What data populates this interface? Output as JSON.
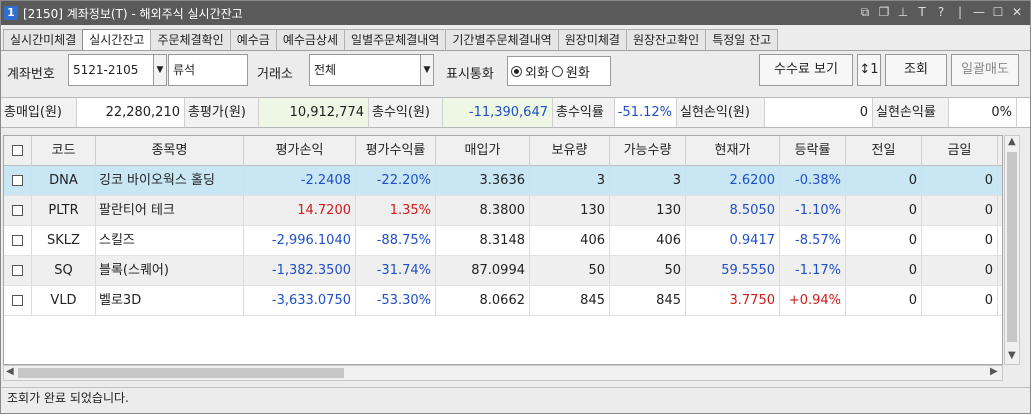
{
  "window": {
    "number": "1",
    "title": "[2150] 계좌정보(T) - 해외주식 실시간잔고",
    "icons": [
      "restore-icon",
      "copy-icon",
      "pin-icon",
      "font-icon",
      "help-icon",
      "minimize-icon",
      "maximize-icon",
      "close-icon"
    ]
  },
  "tabs": [
    {
      "label": "실시간미체결"
    },
    {
      "label": "실시간잔고",
      "active": true
    },
    {
      "label": "주문체결확인"
    },
    {
      "label": "예수금"
    },
    {
      "label": "예수금상세"
    },
    {
      "label": "일별주문체결내역"
    },
    {
      "label": "기간별주문체결내역"
    },
    {
      "label": "원장미체결"
    },
    {
      "label": "원장잔고확인"
    },
    {
      "label": "특정일 잔고"
    }
  ],
  "filter": {
    "account_label": "계좌번호",
    "account_value": "5121-2105",
    "account_name": "류석",
    "exchange_label": "거래소",
    "exchange_value": "전체",
    "currency_label": "표시통화",
    "radio_foreign": "외화",
    "radio_won": "원화",
    "fee_button": "수수료 보기",
    "query_button": "조회",
    "sell_all_button": "일괄매도"
  },
  "summary": {
    "total_buy_label": "총매입(원)",
    "total_buy_value": "22,280,210",
    "total_eval_label": "총평가(원)",
    "total_eval_value": "10,912,774",
    "total_profit_label": "총수익(원)",
    "total_profit_value": "-11,390,647",
    "total_rate_label": "총수익률",
    "total_rate_value": "-51.12%",
    "realized_label": "실현손익(원)",
    "realized_value": "0",
    "realized_rate_label": "실현손익률",
    "realized_rate_value": "0%"
  },
  "table": {
    "headers": [
      "코드",
      "종목명",
      "평가손익",
      "평가수익률",
      "매입가",
      "보유량",
      "가능수량",
      "현재가",
      "등락률",
      "전일",
      "금일"
    ],
    "rows": [
      {
        "code": "DNA",
        "name": "깅코 바이오웍스 홀딩",
        "pnl": "-2.2408",
        "rate": "-22.20%",
        "buy": "3.3636",
        "qty": "3",
        "avail": "3",
        "price": "2.6200",
        "chg": "-0.38%",
        "prev": "0",
        "today": "0"
      },
      {
        "code": "PLTR",
        "name": "팔란티어 테크",
        "pnl": "14.7200",
        "rate": "1.35%",
        "buy": "8.3800",
        "qty": "130",
        "avail": "130",
        "price": "8.5050",
        "chg": "-1.10%",
        "prev": "0",
        "today": "0"
      },
      {
        "code": "SKLZ",
        "name": "스킬즈",
        "pnl": "-2,996.1040",
        "rate": "-88.75%",
        "buy": "8.3148",
        "qty": "406",
        "avail": "406",
        "price": "0.9417",
        "chg": "-8.57%",
        "prev": "0",
        "today": "0"
      },
      {
        "code": "SQ",
        "name": "블록(스퀘어)",
        "pnl": "-1,382.3500",
        "rate": "-31.74%",
        "buy": "87.0994",
        "qty": "50",
        "avail": "50",
        "price": "59.5550",
        "chg": "-1.17%",
        "prev": "0",
        "today": "0"
      },
      {
        "code": "VLD",
        "name": "벨로3D",
        "pnl": "-3,633.0750",
        "rate": "-53.30%",
        "buy": "8.0662",
        "qty": "845",
        "avail": "845",
        "price": "3.7750",
        "chg": "+0.94%",
        "prev": "0",
        "today": "0"
      }
    ]
  },
  "status": "조회가 완료 되었습니다.",
  "colors": {
    "negative": "#1e4fc8",
    "positive": "#d21a1a",
    "selected_row": "#c8e6f4"
  }
}
